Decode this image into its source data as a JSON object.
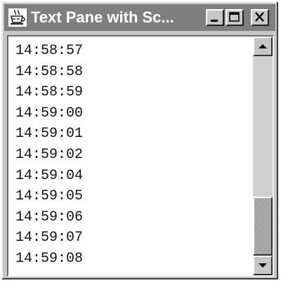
{
  "window": {
    "title": "Text Pane with Sc...",
    "app_icon": "java-cup-icon",
    "controls": [
      "minimize-icon",
      "maximize-icon",
      "close-icon"
    ]
  },
  "text_pane": {
    "lines": [
      "14:58:57",
      "14:58:58",
      "14:58:59",
      "14:59:00",
      "14:59:01",
      "14:59:02",
      "14:59:04",
      "14:59:05",
      "14:59:06",
      "14:59:07",
      "14:59:08"
    ]
  },
  "scrollbar": {
    "up_icon": "up-arrow-icon",
    "down_icon": "down-arrow-icon",
    "position_fraction": 1.0
  },
  "colors": {
    "title_bar": "#7f7f7f",
    "title_text": "#ffffff",
    "window_face": "#c6c6c6",
    "pane_background": "#ffffff"
  }
}
